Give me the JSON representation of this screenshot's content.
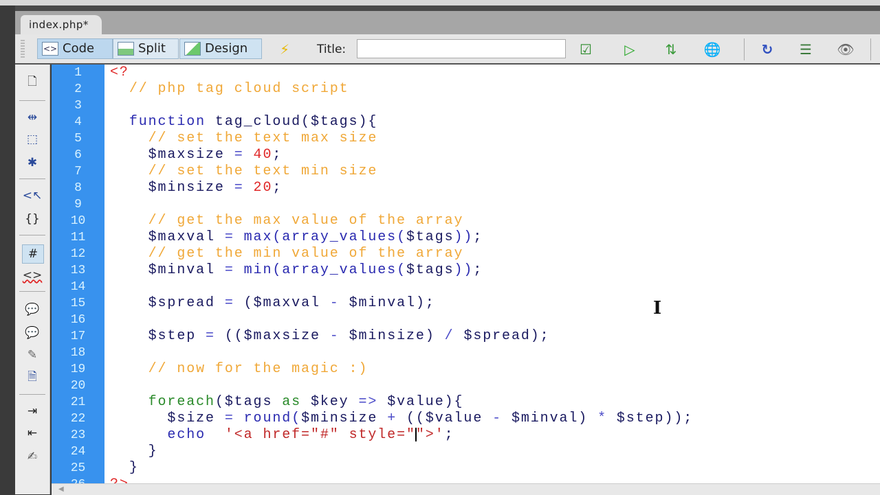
{
  "document_tab": {
    "label": "index.php*"
  },
  "toolbar": {
    "code_label": "Code",
    "split_label": "Split",
    "design_label": "Design",
    "title_label": "Title:",
    "title_value": "",
    "icons": [
      "live-view-icon",
      "validate-markup-icon",
      "preview-debug-icon",
      "file-transfer-icon",
      "browser-check-icon",
      "refresh-icon",
      "view-options-icon",
      "visual-aids-icon"
    ]
  },
  "sidebar": {
    "icons": [
      "open-documents-icon",
      "collapse-tag-icon",
      "collapse-selection-icon",
      "expand-all-icon",
      "select-parent-tag-icon",
      "balance-braces-icon",
      "line-numbers-icon",
      "highlight-invalid-code-icon",
      "apply-comment-icon",
      "remove-comment-icon",
      "wrap-tag-icon",
      "recent-snippets-icon",
      "indent-code-icon",
      "outdent-code-icon",
      "format-source-icon"
    ]
  },
  "editor": {
    "colors": {
      "gutter": "#3892ee",
      "comment": "#f0a838",
      "keyword": "#2a2ab0",
      "control": "#2a8a2a",
      "number": "#e02828",
      "string": "#c02828"
    },
    "cursor": {
      "line": 23,
      "after": "style=\""
    },
    "lines": [
      [
        [
          "tag",
          "<?"
        ]
      ],
      [
        [
          "",
          "  "
        ],
        [
          "comment",
          "// php tag cloud script"
        ]
      ],
      [],
      [
        [
          "",
          "  "
        ],
        [
          "kw",
          "function"
        ],
        [
          "punc",
          " tag_cloud("
        ],
        [
          "var",
          "$tags"
        ],
        [
          "punc",
          "){"
        ]
      ],
      [
        [
          "",
          "    "
        ],
        [
          "comment",
          "// set the text max size"
        ]
      ],
      [
        [
          "",
          "    "
        ],
        [
          "var",
          "$maxsize"
        ],
        [
          "op",
          " = "
        ],
        [
          "num",
          "40"
        ],
        [
          "punc",
          ";"
        ]
      ],
      [
        [
          "",
          "    "
        ],
        [
          "comment",
          "// set the text min size"
        ]
      ],
      [
        [
          "",
          "    "
        ],
        [
          "var",
          "$minsize"
        ],
        [
          "op",
          " = "
        ],
        [
          "num",
          "20"
        ],
        [
          "punc",
          ";"
        ]
      ],
      [],
      [
        [
          "",
          "    "
        ],
        [
          "comment",
          "// get the max value of the array"
        ]
      ],
      [
        [
          "",
          "    "
        ],
        [
          "var",
          "$maxval"
        ],
        [
          "op",
          " = "
        ],
        [
          "fn",
          "max(array_values("
        ],
        [
          "var",
          "$tags"
        ],
        [
          "fn",
          "))"
        ],
        [
          "punc",
          ";"
        ]
      ],
      [
        [
          "",
          "    "
        ],
        [
          "comment",
          "// get the min value of the array"
        ]
      ],
      [
        [
          "",
          "    "
        ],
        [
          "var",
          "$minval"
        ],
        [
          "op",
          " = "
        ],
        [
          "fn",
          "min(array_values("
        ],
        [
          "var",
          "$tags"
        ],
        [
          "fn",
          "))"
        ],
        [
          "punc",
          ";"
        ]
      ],
      [],
      [
        [
          "",
          "    "
        ],
        [
          "var",
          "$spread"
        ],
        [
          "op",
          " = "
        ],
        [
          "punc",
          "("
        ],
        [
          "var",
          "$maxval"
        ],
        [
          "op",
          " - "
        ],
        [
          "var",
          "$minval"
        ],
        [
          "punc",
          ");"
        ]
      ],
      [],
      [
        [
          "",
          "    "
        ],
        [
          "var",
          "$step"
        ],
        [
          "op",
          " = "
        ],
        [
          "punc",
          "(("
        ],
        [
          "var",
          "$maxsize"
        ],
        [
          "op",
          " - "
        ],
        [
          "var",
          "$minsize"
        ],
        [
          "punc",
          ")"
        ],
        [
          "op",
          " / "
        ],
        [
          "var",
          "$spread"
        ],
        [
          "punc",
          ");"
        ]
      ],
      [],
      [
        [
          "",
          "    "
        ],
        [
          "comment",
          "// now for the magic :)"
        ]
      ],
      [],
      [
        [
          "",
          "    "
        ],
        [
          "ctl",
          "foreach"
        ],
        [
          "punc",
          "("
        ],
        [
          "var",
          "$tags"
        ],
        [
          "ctl",
          " as "
        ],
        [
          "var",
          "$key"
        ],
        [
          "op",
          " => "
        ],
        [
          "var",
          "$value"
        ],
        [
          "punc",
          "){"
        ]
      ],
      [
        [
          "",
          "      "
        ],
        [
          "var",
          "$size"
        ],
        [
          "op",
          " = "
        ],
        [
          "fn",
          "round("
        ],
        [
          "var",
          "$minsize"
        ],
        [
          "op",
          " + "
        ],
        [
          "punc",
          "(("
        ],
        [
          "var",
          "$value"
        ],
        [
          "op",
          " - "
        ],
        [
          "var",
          "$minval"
        ],
        [
          "punc",
          ")"
        ],
        [
          "op",
          " * "
        ],
        [
          "var",
          "$step"
        ],
        [
          "punc",
          "));"
        ]
      ],
      [
        [
          "",
          "      "
        ],
        [
          "fn",
          "echo"
        ],
        [
          "",
          "  "
        ],
        [
          "str",
          "'<a href=\"#\" style=\""
        ],
        [
          "caret",
          ""
        ],
        [
          "str",
          "\">'"
        ],
        [
          "punc",
          ";"
        ]
      ],
      [
        [
          "",
          "    "
        ],
        [
          "punc",
          "}"
        ]
      ],
      [
        [
          "",
          "  "
        ],
        [
          "punc",
          "}"
        ]
      ],
      [
        [
          "tag",
          "?>"
        ]
      ]
    ]
  }
}
